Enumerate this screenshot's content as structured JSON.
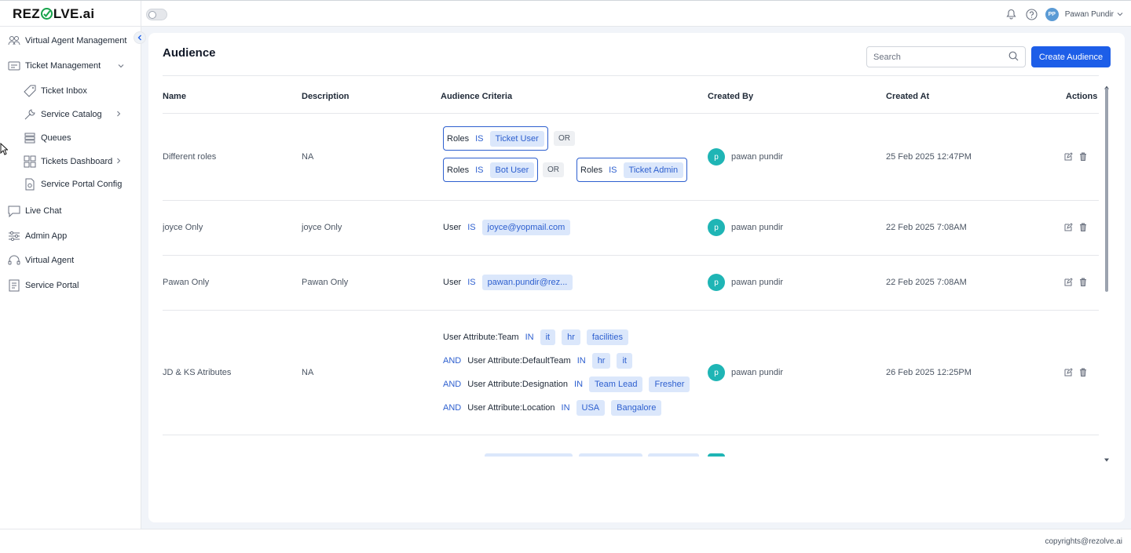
{
  "app": {
    "logo": "REZOLVE.ai",
    "logo_prefix": "REZ",
    "logo_suffix": "LVE.ai"
  },
  "header": {
    "user_initials": "PP",
    "user_name": "Pawan Pundir"
  },
  "sidebar": {
    "items": [
      {
        "label": "Virtual Agent Management",
        "icon": "users-icon"
      },
      {
        "label": "Ticket Management",
        "icon": "ticket-management-icon"
      },
      {
        "label": "Ticket Inbox",
        "icon": "tag-icon"
      },
      {
        "label": "Service Catalog",
        "icon": "wrench-icon"
      },
      {
        "label": "Queues",
        "icon": "stack-icon"
      },
      {
        "label": "Tickets Dashboard",
        "icon": "grid-icon"
      },
      {
        "label": "Service Portal Config",
        "icon": "document-gear-icon"
      },
      {
        "label": "Live Chat",
        "icon": "chat-icon"
      },
      {
        "label": "Admin App",
        "icon": "sliders-icon"
      },
      {
        "label": "Virtual Agent",
        "icon": "headset-icon"
      },
      {
        "label": "Service Portal",
        "icon": "portal-icon"
      }
    ]
  },
  "page": {
    "title": "Audience",
    "search_placeholder": "Search",
    "create_label": "Create Audience"
  },
  "table": {
    "columns": [
      "Name",
      "Description",
      "Audience Criteria",
      "Created By",
      "Created At",
      "Actions"
    ],
    "rows": [
      {
        "name": "Different roles",
        "description": "NA",
        "criteria": {
          "g1": {
            "label": "Roles",
            "op": "IS",
            "value": "Ticket User"
          },
          "or1": "OR",
          "g2": {
            "label": "Roles",
            "op": "IS",
            "value": "Bot User"
          },
          "or2": "OR",
          "g3": {
            "label": "Roles",
            "op": "IS",
            "value": "Ticket Admin"
          }
        },
        "avatar": "p",
        "created_by": "pawan pundir",
        "created_at": "25 Feb 2025 12:47PM"
      },
      {
        "name": "joyce Only",
        "description": "joyce Only",
        "criteria": {
          "label": "User",
          "op": "IS",
          "value": "joyce@yopmail.com"
        },
        "avatar": "p",
        "created_by": "pawan pundir",
        "created_at": "22 Feb 2025 7:08AM"
      },
      {
        "name": "Pawan Only",
        "description": "Pawan Only",
        "criteria": {
          "label": "User",
          "op": "IS",
          "value": "pawan.pundir@rez..."
        },
        "avatar": "p",
        "created_by": "pawan pundir",
        "created_at": "22 Feb 2025 7:08AM"
      },
      {
        "name": "JD & KS Atributes",
        "description": "NA",
        "criteria": {
          "l1": {
            "label": "User Attribute:Team",
            "op": "IN",
            "values": [
              "it",
              "hr",
              "facilities"
            ]
          },
          "l2": {
            "conj": "AND",
            "label": "User Attribute:DefaultTeam",
            "op": "IN",
            "values": [
              "hr",
              "it"
            ]
          },
          "l3": {
            "conj": "AND",
            "label": "User Attribute:Designation",
            "op": "IN",
            "values": [
              "Team Lead",
              "Fresher"
            ]
          },
          "l4": {
            "conj": "AND",
            "label": "User Attribute:Location",
            "op": "IN",
            "values": [
              "USA",
              "Bangalore"
            ]
          }
        },
        "avatar": "p",
        "created_by": "pawan pundir",
        "created_at": "26 Feb 2025 12:25PM"
      }
    ]
  },
  "footer": {
    "copyright": "copyrights@rezolve.ai"
  },
  "colors": {
    "primary": "#1d5ee8",
    "chip_bg": "#dbe7fb",
    "chip_text": "#2d5fcf",
    "avatar": "#1fb5b5",
    "background": "#f1f4f9"
  }
}
